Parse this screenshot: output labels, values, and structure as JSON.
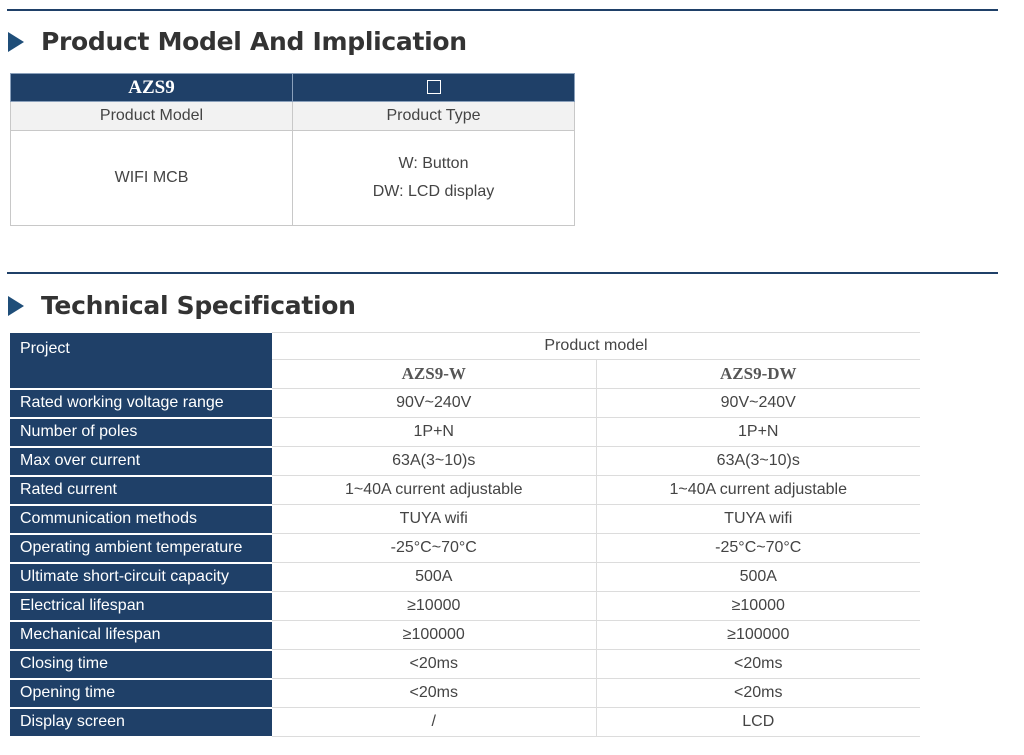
{
  "sections": {
    "model": {
      "title": "Product Model And Implication"
    },
    "spec": {
      "title": "Technical Specification"
    }
  },
  "model_table": {
    "code": "AZS9",
    "code_box_icon": "empty-box-icon",
    "col1_label": "Product Model",
    "col2_label": "Product Type",
    "col1_value": "WIFI MCB",
    "col2_values": [
      "W: Button",
      "DW: LCD display"
    ]
  },
  "spec_table": {
    "project_label": "Project",
    "product_model_label": "Product model",
    "models": [
      "AZS9-W",
      "AZS9-DW"
    ],
    "rows": [
      {
        "label": "Rated working voltage range",
        "w": "90V~240V",
        "dw": "90V~240V"
      },
      {
        "label": "Number of poles",
        "w": "1P+N",
        "dw": "1P+N"
      },
      {
        "label": "Max over current",
        "w": "63A(3~10)s",
        "dw": "63A(3~10)s"
      },
      {
        "label": "Rated current",
        "w": "1~40A current adjustable",
        "dw": "1~40A current adjustable"
      },
      {
        "label": "Communication methods",
        "w": "TUYA wifi",
        "dw": "TUYA wifi"
      },
      {
        "label": "Operating ambient temperature",
        "w": "-25°C~70°C",
        "dw": "-25°C~70°C"
      },
      {
        "label": "Ultimate short-circuit capacity",
        "w": "500A",
        "dw": "500A"
      },
      {
        "label": "Electrical lifespan",
        "w": "≥10000",
        "dw": "≥10000"
      },
      {
        "label": "Mechanical lifespan",
        "w": "≥100000",
        "dw": "≥100000"
      },
      {
        "label": "Closing time",
        "w": "<20ms",
        "dw": "<20ms"
      },
      {
        "label": "Opening time",
        "w": "<20ms",
        "dw": "<20ms"
      },
      {
        "label": "Display screen",
        "w": "/",
        "dw": "LCD"
      }
    ]
  },
  "colors": {
    "accent": "#1f4068",
    "triangle": "#1f4e79"
  }
}
